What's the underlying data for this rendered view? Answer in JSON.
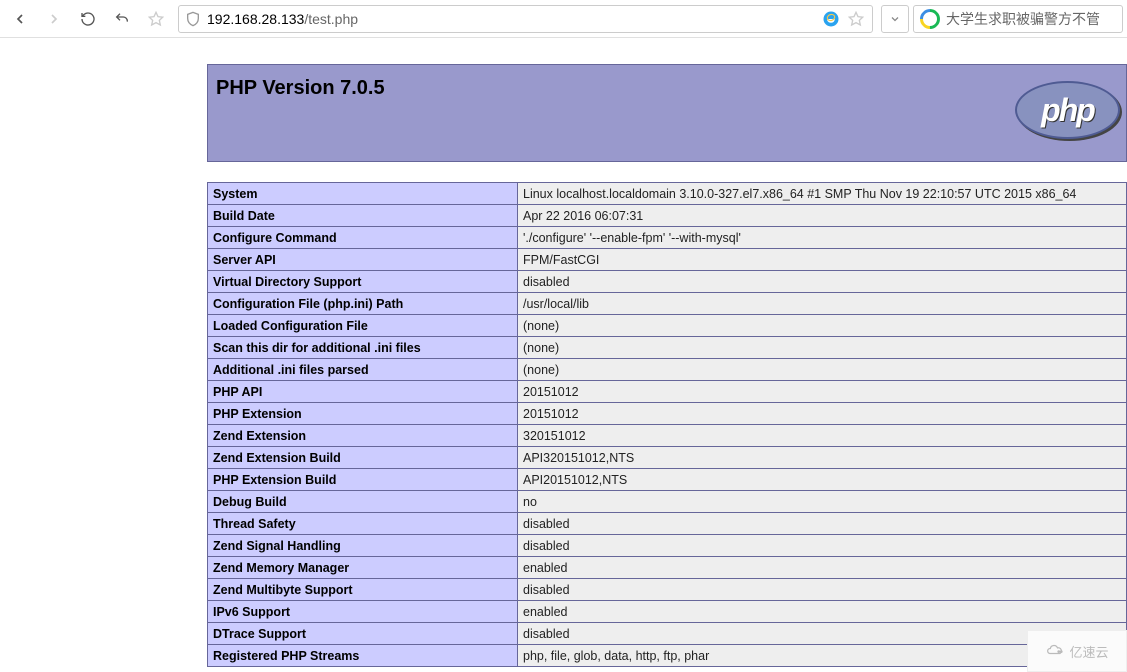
{
  "browser": {
    "url_host": "192.168.28.133",
    "url_path": "/test.php",
    "search_placeholder": "大学生求职被骗警方不管"
  },
  "page": {
    "title": "PHP Version 7.0.5",
    "logo_text": "php"
  },
  "rows": [
    {
      "k": "System",
      "v": "Linux localhost.localdomain 3.10.0-327.el7.x86_64 #1 SMP Thu Nov 19 22:10:57 UTC 2015 x86_64"
    },
    {
      "k": "Build Date",
      "v": "Apr 22 2016 06:07:31"
    },
    {
      "k": "Configure Command",
      "v": "'./configure' '--enable-fpm' '--with-mysql'"
    },
    {
      "k": "Server API",
      "v": "FPM/FastCGI"
    },
    {
      "k": "Virtual Directory Support",
      "v": "disabled"
    },
    {
      "k": "Configuration File (php.ini) Path",
      "v": "/usr/local/lib"
    },
    {
      "k": "Loaded Configuration File",
      "v": "(none)"
    },
    {
      "k": "Scan this dir for additional .ini files",
      "v": "(none)"
    },
    {
      "k": "Additional .ini files parsed",
      "v": "(none)"
    },
    {
      "k": "PHP API",
      "v": "20151012"
    },
    {
      "k": "PHP Extension",
      "v": "20151012"
    },
    {
      "k": "Zend Extension",
      "v": "320151012"
    },
    {
      "k": "Zend Extension Build",
      "v": "API320151012,NTS"
    },
    {
      "k": "PHP Extension Build",
      "v": "API20151012,NTS"
    },
    {
      "k": "Debug Build",
      "v": "no"
    },
    {
      "k": "Thread Safety",
      "v": "disabled"
    },
    {
      "k": "Zend Signal Handling",
      "v": "disabled"
    },
    {
      "k": "Zend Memory Manager",
      "v": "enabled"
    },
    {
      "k": "Zend Multibyte Support",
      "v": "disabled"
    },
    {
      "k": "IPv6 Support",
      "v": "enabled"
    },
    {
      "k": "DTrace Support",
      "v": "disabled"
    },
    {
      "k": "Registered PHP Streams",
      "v": "php, file, glob, data, http, ftp, phar"
    }
  ],
  "watermark": "亿速云"
}
